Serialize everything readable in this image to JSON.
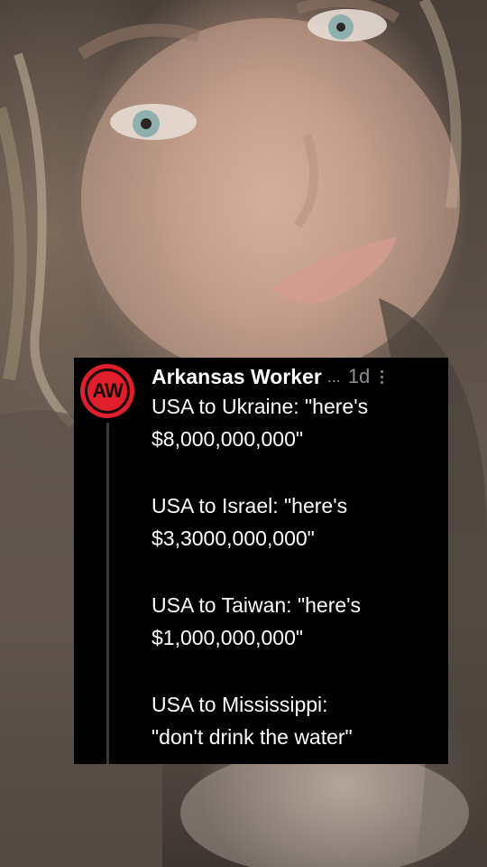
{
  "tweet": {
    "author": "Arkansas Worker",
    "truncation": "...",
    "timestamp": "1d",
    "avatar_text": "AW",
    "avatar_color": "#e01f2d",
    "paragraphs": [
      {
        "line1": "USA to Ukraine: \"here's",
        "line2": "$8,000,000,000\""
      },
      {
        "line1": "USA to Israel: \"here's",
        "line2": "$3,3000,000,000\""
      },
      {
        "line1": "USA to Taiwan: \"here's",
        "line2": "$1,000,000,000\""
      },
      {
        "line1": "USA to Mississippi:",
        "line2": "\"don't drink the water\""
      }
    ]
  },
  "icons": {
    "avatar": "avatar-logo",
    "more": "more-icon"
  }
}
